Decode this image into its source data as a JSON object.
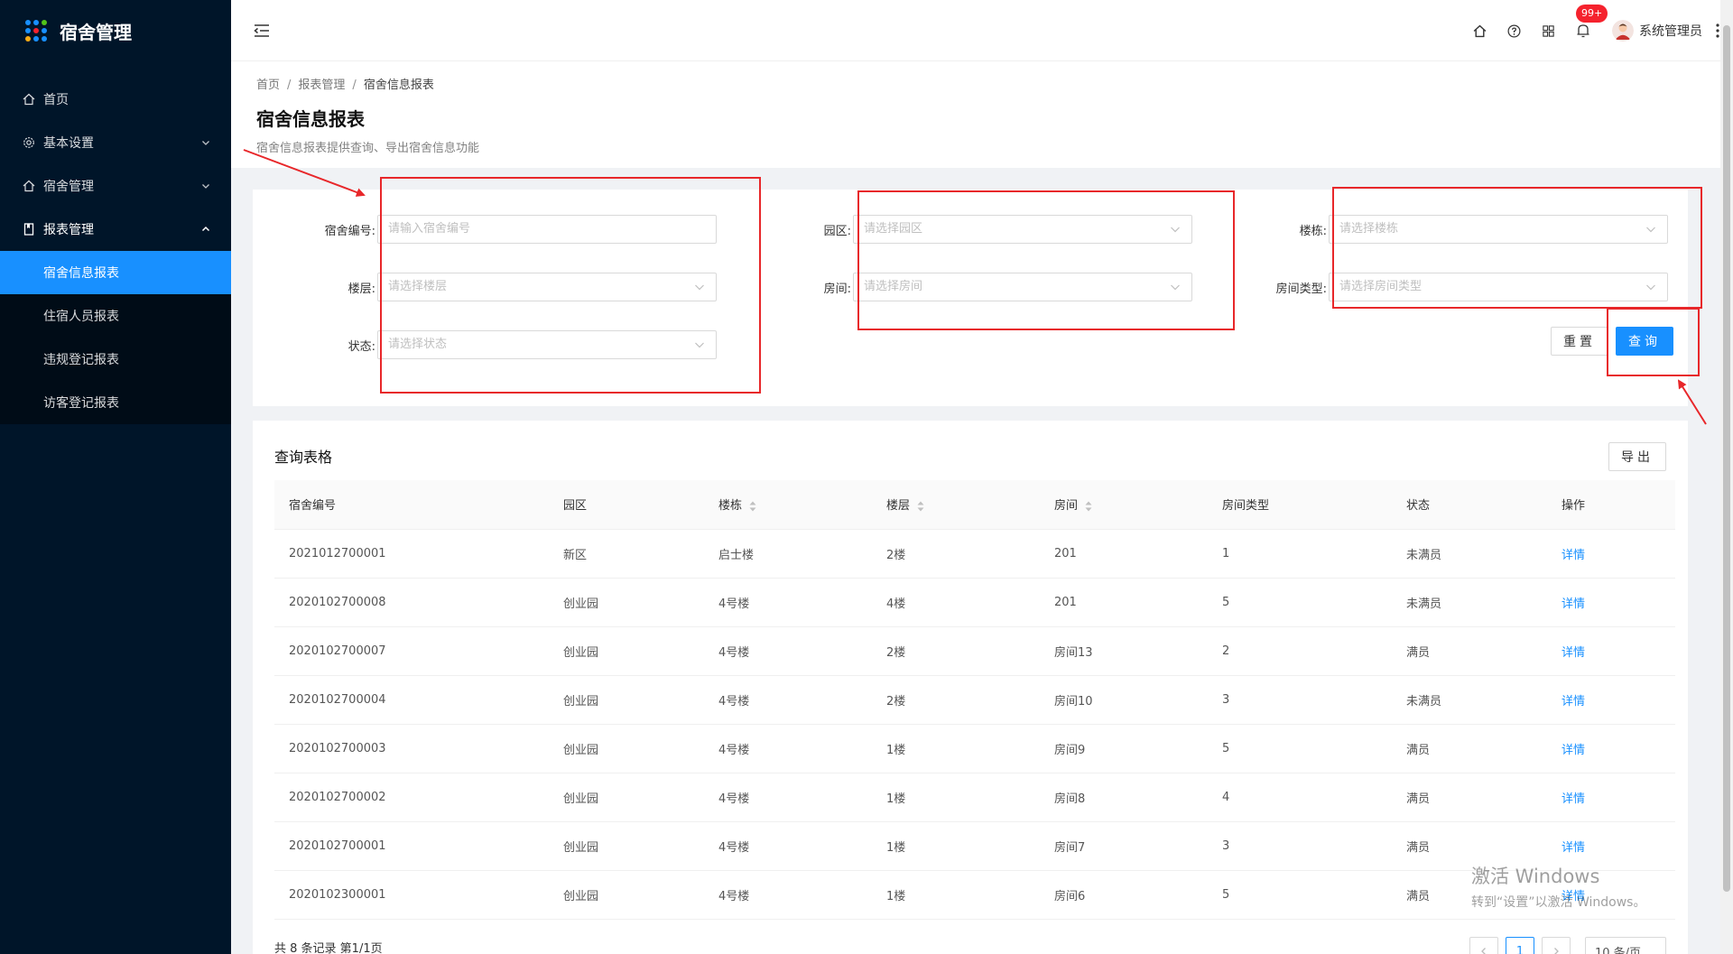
{
  "sidebar": {
    "title": "宿舍管理",
    "menu": [
      {
        "label": "首页"
      },
      {
        "label": "基本设置"
      },
      {
        "label": "宿舍管理"
      },
      {
        "label": "报表管理"
      }
    ],
    "submenu": [
      {
        "label": "宿舍信息报表"
      },
      {
        "label": "住宿人员报表"
      },
      {
        "label": "违规登记报表"
      },
      {
        "label": "访客登记报表"
      }
    ]
  },
  "header": {
    "badge": "99+",
    "username": "系统管理员"
  },
  "breadcrumb": [
    "首页",
    "报表管理",
    "宿舍信息报表"
  ],
  "page": {
    "title": "宿舍信息报表",
    "description": "宿舍信息报表提供查询、导出宿舍信息功能"
  },
  "filters": {
    "dorm_no": {
      "label": "宿舍编号:",
      "placeholder": "请输入宿舍编号"
    },
    "park": {
      "label": "园区:",
      "placeholder": "请选择园区"
    },
    "building": {
      "label": "楼栋:",
      "placeholder": "请选择楼栋"
    },
    "floor": {
      "label": "楼层:",
      "placeholder": "请选择楼层"
    },
    "room": {
      "label": "房间:",
      "placeholder": "请选择房间"
    },
    "room_type": {
      "label": "房间类型:",
      "placeholder": "请选择房间类型"
    },
    "status": {
      "label": "状态:",
      "placeholder": "请选择状态"
    },
    "reset_label": "重置",
    "query_label": "查询"
  },
  "table": {
    "title": "查询表格",
    "export_label": "导出",
    "columns": [
      "宿舍编号",
      "园区",
      "楼栋",
      "楼层",
      "房间",
      "房间类型",
      "状态",
      "操作"
    ],
    "rows": [
      [
        "2021012700001",
        "新区",
        "启士楼",
        "2楼",
        "201",
        "1",
        "未满员",
        "详情"
      ],
      [
        "2020102700008",
        "创业园",
        "4号楼",
        "4楼",
        "201",
        "5",
        "未满员",
        "详情"
      ],
      [
        "2020102700007",
        "创业园",
        "4号楼",
        "2楼",
        "房间13",
        "2",
        "满员",
        "详情"
      ],
      [
        "2020102700004",
        "创业园",
        "4号楼",
        "2楼",
        "房间10",
        "3",
        "未满员",
        "详情"
      ],
      [
        "2020102700003",
        "创业园",
        "4号楼",
        "1楼",
        "房间9",
        "5",
        "满员",
        "详情"
      ],
      [
        "2020102700002",
        "创业园",
        "4号楼",
        "1楼",
        "房间8",
        "4",
        "满员",
        "详情"
      ],
      [
        "2020102700001",
        "创业园",
        "4号楼",
        "1楼",
        "房间7",
        "3",
        "满员",
        "详情"
      ],
      [
        "2020102300001",
        "创业园",
        "4号楼",
        "1楼",
        "房间6",
        "5",
        "满员",
        "详情"
      ]
    ],
    "total_text": "共 8 条记录 第1/1页",
    "current_page": "1",
    "page_size": "10 条/页"
  },
  "watermark": {
    "line1": "激活 Windows",
    "line2": "转到“设置”以激活 Windows。"
  },
  "colors": {
    "sidebar_bg": "#001529",
    "primary": "#1890ff",
    "annotation": "#e8272a"
  }
}
